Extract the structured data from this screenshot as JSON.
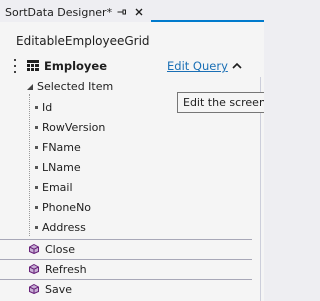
{
  "tab": {
    "title": "SortData Designer*",
    "pin_icon": "pin-icon",
    "close_icon": "close-icon"
  },
  "screen_name": "EditableEmployeeGrid",
  "collection": {
    "label": "Employee",
    "edit_query_label": "Edit Query",
    "collapse_icon": "chevron-up-icon"
  },
  "selected_item": {
    "label": "Selected Item",
    "fields": [
      "Id",
      "RowVersion",
      "FName",
      "LName",
      "Email",
      "PhoneNo",
      "Address"
    ]
  },
  "methods": [
    {
      "label": "Close",
      "icon": "method-icon"
    },
    {
      "label": "Refresh",
      "icon": "method-icon"
    },
    {
      "label": "Save",
      "icon": "method-icon"
    }
  ],
  "tooltip": {
    "text": "Edit the screen"
  },
  "colors": {
    "accent": "#007acc",
    "link": "#1a6fb5",
    "method_icon": "#68217a"
  }
}
